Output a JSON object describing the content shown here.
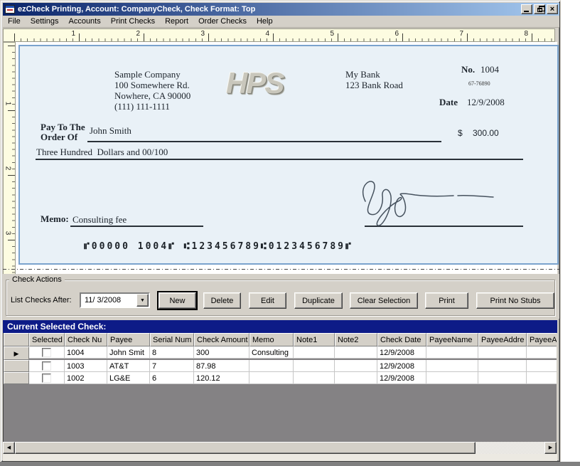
{
  "window": {
    "title": "ezCheck Printing, Account: CompanyCheck, Check Format: Top"
  },
  "icons": {
    "dropdown": "▼",
    "row_pointer": "▶",
    "scroll_left": "◀",
    "scroll_right": "▶"
  },
  "menu": {
    "items": [
      "File",
      "Settings",
      "Accounts",
      "Print Checks",
      "Report",
      "Order Checks",
      "Help"
    ]
  },
  "ruler": {
    "horizontal": [
      "1",
      "2",
      "3",
      "4",
      "5",
      "6",
      "7",
      "8"
    ],
    "vertical": [
      "1",
      "2",
      "3"
    ]
  },
  "check": {
    "company": {
      "name": "Sample Company",
      "address1": "100 Somewhere Rd.",
      "address2": "Nowhere, CA 90000",
      "phone": "(111) 111-1111"
    },
    "logo": "HPS",
    "bank": {
      "name": "My Bank",
      "address": "123 Bank Road"
    },
    "number_label": "No.",
    "number": "1004",
    "fraction": "67-76890",
    "date_label": "Date",
    "date_value": "12/9/2008",
    "payto_label_line1": "Pay To The",
    "payto_label_line2": "Order Of",
    "payee": "John Smith",
    "dollar_sign": "$",
    "amount": "300.00",
    "amount_words": "Three Hundred  Dollars and 00/100",
    "memo_label": "Memo:",
    "memo": "Consulting fee",
    "micr": "⑈00000 1004⑈ ⑆123456789⑆0123456789⑈"
  },
  "actions": {
    "group_label": "Check Actions",
    "list_after_label": "List Checks After:",
    "date_value": "11/ 3/2008",
    "buttons": {
      "new": "New",
      "delete": "Delete",
      "edit": "Edit",
      "duplicate": "Duplicate",
      "clear_selection": "Clear Selection",
      "print": "Print",
      "print_no_stubs": "Print No Stubs"
    }
  },
  "grid": {
    "title": "Current Selected Check:",
    "columns": [
      "Selected",
      "Check Nu",
      "Payee",
      "Serial Num",
      "Check Amount",
      "Memo",
      "Note1",
      "Note2",
      "Check Date",
      "PayeeName",
      "PayeeAddre",
      "PayeeAc"
    ],
    "rows": [
      {
        "check_nu": "1004",
        "payee": "John Smit",
        "serial": "8",
        "amount": "300",
        "memo": "Consulting",
        "note1": "",
        "note2": "",
        "date": "12/9/2008",
        "payee_name": "",
        "payee_addr": "",
        "payee_ac": ""
      },
      {
        "check_nu": "1003",
        "payee": "AT&T",
        "serial": "7",
        "amount": "87.98",
        "memo": "",
        "note1": "",
        "note2": "",
        "date": "12/9/2008",
        "payee_name": "",
        "payee_addr": "",
        "payee_ac": ""
      },
      {
        "check_nu": "1002",
        "payee": "LG&E",
        "serial": "6",
        "amount": "120.12",
        "memo": "",
        "note1": "",
        "note2": "",
        "date": "12/9/2008",
        "payee_name": "",
        "payee_addr": "",
        "payee_ac": ""
      }
    ]
  },
  "colors": {
    "titlebar_left": "#0a246a",
    "titlebar_right": "#a6caf0",
    "chrome": "#d4d0c8",
    "ruler_bg": "#fdfce1",
    "check_bg": "#e9f1f7",
    "check_border": "#7aa3cd",
    "grid_header_bar": "#0d1b87",
    "grid_filler": "#848284"
  }
}
